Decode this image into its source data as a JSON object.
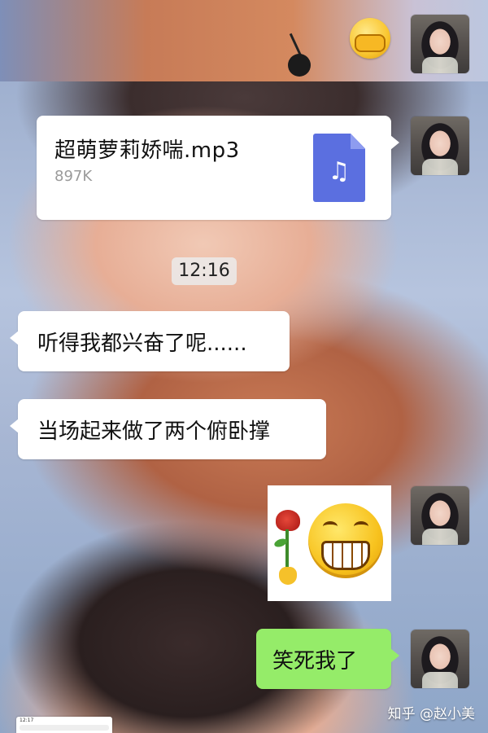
{
  "chat": {
    "file_message": {
      "name": "超萌萝莉娇喘.mp3",
      "size": "897K",
      "icon": "music-note-icon"
    },
    "timestamp": "12:16",
    "messages": [
      {
        "side": "left",
        "text": "听得我都兴奋了呢......"
      },
      {
        "side": "left",
        "text": "当场起来做了两个俯卧撑"
      },
      {
        "side": "right",
        "type": "sticker",
        "icon": "grinning-face-with-rose-sticker"
      },
      {
        "side": "right",
        "text": "笑死我了"
      }
    ]
  },
  "watermark": "知乎 @赵小美",
  "mini_screenshot": {
    "time": "12:17"
  },
  "colors": {
    "own_bubble": "#95ec69",
    "other_bubble": "#ffffff",
    "file_icon": "#5b6fe0"
  }
}
